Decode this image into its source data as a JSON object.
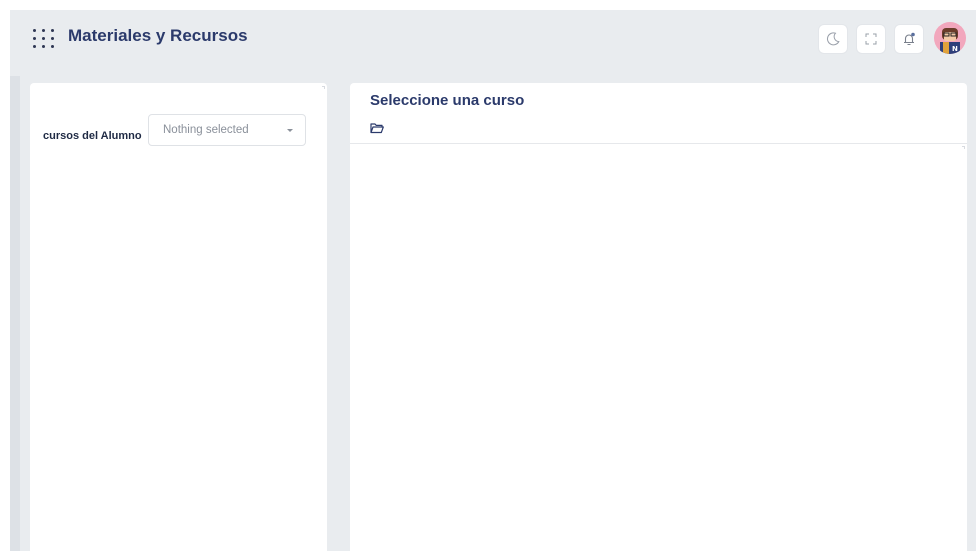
{
  "header": {
    "title": "Materiales y Recursos",
    "icons": [
      "apps-grid-icon",
      "moon-icon",
      "fullscreen-icon",
      "bell-icon",
      "user-avatar"
    ]
  },
  "left_panel": {
    "field_label": "cursos del Alumno",
    "select": {
      "value": "Nothing selected"
    }
  },
  "right_panel": {
    "title": "Seleccione una curso",
    "icon": "folder-open-icon"
  },
  "colors": {
    "page_background": "#e9ecef",
    "title_color": "#2b3a6b",
    "panel_background": "#ffffff"
  }
}
